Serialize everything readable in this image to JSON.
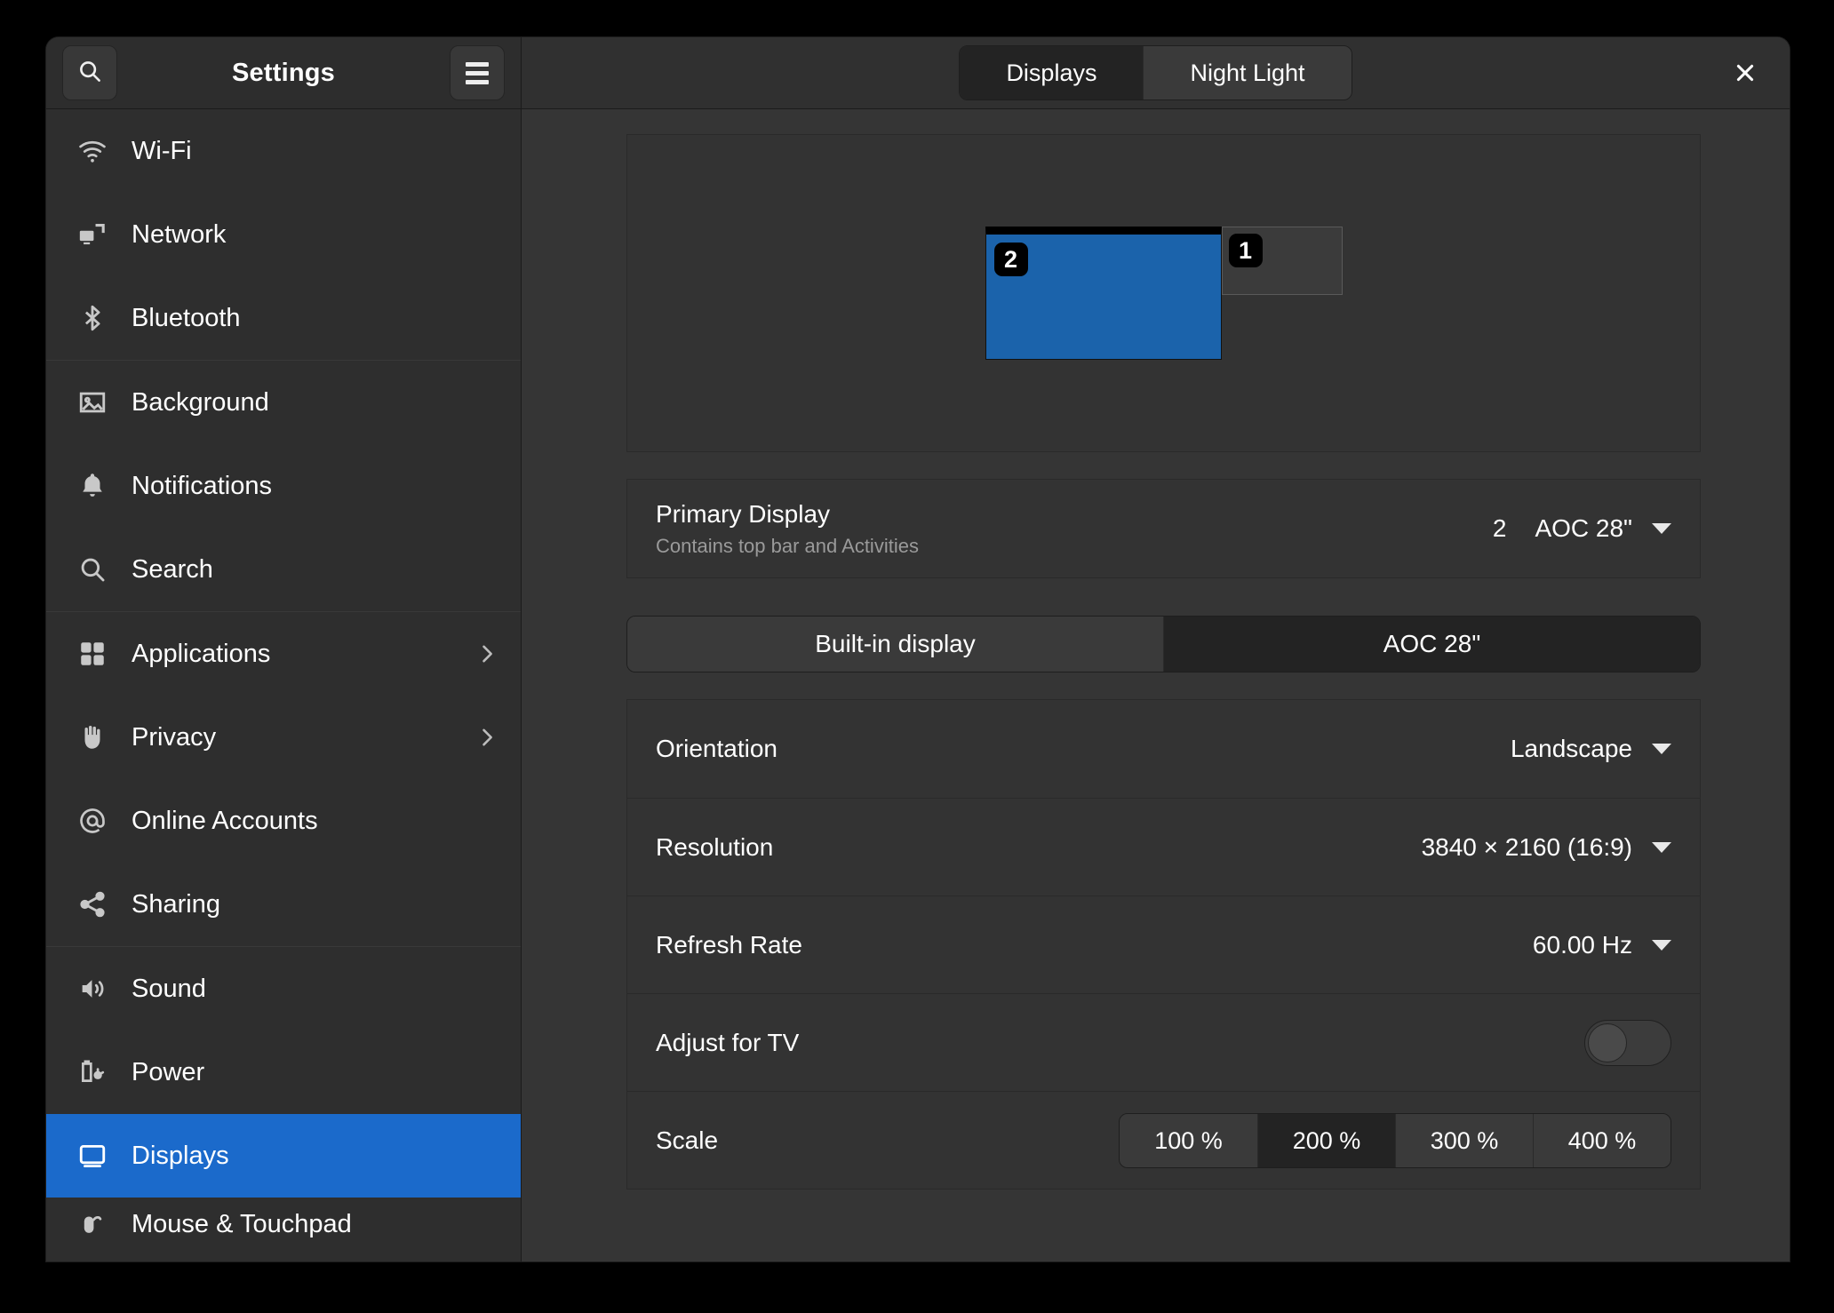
{
  "window": {
    "title": "Settings",
    "close_label": "×"
  },
  "header": {
    "search_icon": "search-icon",
    "menu_icon": "hamburger-menu-icon",
    "tabs": [
      {
        "label": "Displays",
        "active": true
      },
      {
        "label": "Night Light",
        "active": false
      }
    ]
  },
  "sidebar": {
    "groups": [
      {
        "items": [
          {
            "label": "Wi-Fi",
            "icon": "wifi-icon",
            "selected": false,
            "chevron": false
          },
          {
            "label": "Network",
            "icon": "network-icon",
            "selected": false,
            "chevron": false
          },
          {
            "label": "Bluetooth",
            "icon": "bluetooth-icon",
            "selected": false,
            "chevron": false
          }
        ]
      },
      {
        "items": [
          {
            "label": "Background",
            "icon": "image-icon",
            "selected": false,
            "chevron": false
          },
          {
            "label": "Notifications",
            "icon": "bell-icon",
            "selected": false,
            "chevron": false
          },
          {
            "label": "Search",
            "icon": "search-icon",
            "selected": false,
            "chevron": false
          }
        ]
      },
      {
        "items": [
          {
            "label": "Applications",
            "icon": "grid-icon",
            "selected": false,
            "chevron": true
          },
          {
            "label": "Privacy",
            "icon": "hand-icon",
            "selected": false,
            "chevron": true
          },
          {
            "label": "Online Accounts",
            "icon": "at-sign-icon",
            "selected": false,
            "chevron": false
          },
          {
            "label": "Sharing",
            "icon": "share-icon",
            "selected": false,
            "chevron": false
          }
        ]
      },
      {
        "items": [
          {
            "label": "Sound",
            "icon": "speaker-icon",
            "selected": false,
            "chevron": false
          },
          {
            "label": "Power",
            "icon": "battery-plug-icon",
            "selected": false,
            "chevron": false
          },
          {
            "label": "Displays",
            "icon": "monitor-icon",
            "selected": true,
            "chevron": false
          },
          {
            "label": "Mouse & Touchpad",
            "icon": "mouse-icon",
            "selected": false,
            "chevron": false
          }
        ]
      }
    ]
  },
  "main": {
    "arrangement": {
      "monitors": [
        {
          "badge": "2",
          "name": "primary"
        },
        {
          "badge": "1",
          "name": "secondary"
        }
      ]
    },
    "primary_display": {
      "title": "Primary Display",
      "subtitle": "Contains top bar and Activities",
      "index": "2",
      "value": "AOC 28\""
    },
    "display_tabs": [
      {
        "label": "Built-in display",
        "active": false
      },
      {
        "label": "AOC 28\"",
        "active": true
      }
    ],
    "settings": {
      "orientation": {
        "label": "Orientation",
        "value": "Landscape"
      },
      "resolution": {
        "label": "Resolution",
        "value": "3840 × 2160 (16:9)"
      },
      "refresh_rate": {
        "label": "Refresh Rate",
        "value": "60.00 Hz"
      },
      "adjust_for_tv": {
        "label": "Adjust for TV",
        "enabled": false
      },
      "scale": {
        "label": "Scale",
        "options": [
          {
            "label": "100 %",
            "active": false
          },
          {
            "label": "200 %",
            "active": true
          },
          {
            "label": "300 %",
            "active": false
          },
          {
            "label": "400 %",
            "active": false
          }
        ]
      }
    }
  },
  "colors": {
    "accent": "#1b6acb",
    "monitor_primary": "#1b63ab",
    "window_bg": "#353535",
    "sidebar_bg": "#2e2e2e",
    "card_bg": "#333333"
  }
}
